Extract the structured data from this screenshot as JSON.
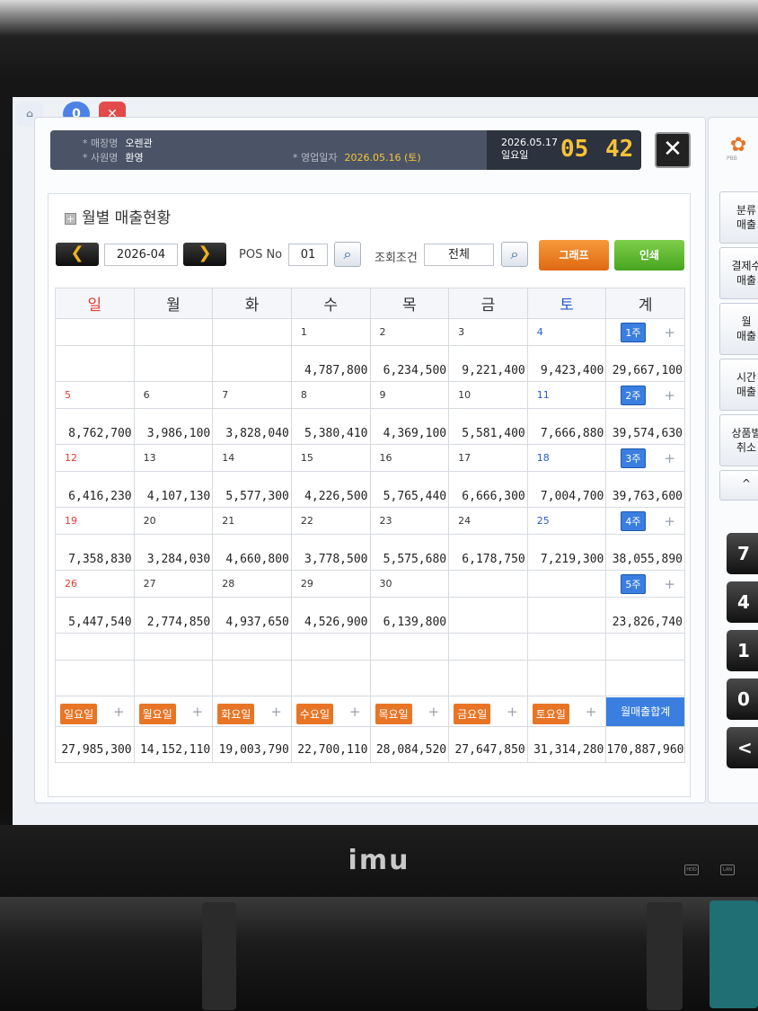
{
  "top_icons": {
    "user_count": "0"
  },
  "info": {
    "store_label": "* 매장명",
    "store_value": "오렌관",
    "staff_label": "* 사원명",
    "staff_value": "환영",
    "bizdate_label": "* 영업일자",
    "bizdate_value": "2026.05.16 (토)",
    "date": "2026.05.17",
    "weekday": "일요일",
    "hour": "05",
    "minute": "42"
  },
  "panel": {
    "title": "월별 매출현황",
    "month": "2026-04",
    "pos_label": "POS No",
    "pos_value": "01",
    "cond_label": "조회조건",
    "cond_value": "전체",
    "graph_label": "그래프",
    "print_label": "인쇄"
  },
  "calendar": {
    "headers": [
      "일",
      "월",
      "화",
      "수",
      "목",
      "금",
      "토",
      "계"
    ],
    "weeks": [
      {
        "days": [
          "",
          "",
          "",
          "1",
          "2",
          "3",
          "4"
        ],
        "amounts": [
          "",
          "",
          "",
          "4,787,800",
          "6,234,500",
          "9,221,400",
          "9,423,400"
        ],
        "week_label": "1주",
        "total": "29,667,100"
      },
      {
        "days": [
          "5",
          "6",
          "7",
          "8",
          "9",
          "10",
          "11"
        ],
        "amounts": [
          "8,762,700",
          "3,986,100",
          "3,828,040",
          "5,380,410",
          "4,369,100",
          "5,581,400",
          "7,666,880"
        ],
        "week_label": "2주",
        "total": "39,574,630"
      },
      {
        "days": [
          "12",
          "13",
          "14",
          "15",
          "16",
          "17",
          "18"
        ],
        "amounts": [
          "6,416,230",
          "4,107,130",
          "5,577,300",
          "4,226,500",
          "5,765,440",
          "6,666,300",
          "7,004,700"
        ],
        "week_label": "3주",
        "total": "39,763,600"
      },
      {
        "days": [
          "19",
          "20",
          "21",
          "22",
          "23",
          "24",
          "25"
        ],
        "amounts": [
          "7,358,830",
          "3,284,030",
          "4,660,800",
          "3,778,500",
          "5,575,680",
          "6,178,750",
          "7,219,300"
        ],
        "week_label": "4주",
        "total": "38,055,890"
      },
      {
        "days": [
          "26",
          "27",
          "28",
          "29",
          "30",
          "",
          ""
        ],
        "amounts": [
          "5,447,540",
          "2,774,850",
          "4,937,650",
          "4,526,900",
          "6,139,800",
          "",
          ""
        ],
        "week_label": "5주",
        "total": "23,826,740"
      }
    ],
    "day_totals": {
      "labels": [
        "일요일",
        "월요일",
        "화요일",
        "수요일",
        "목요일",
        "금요일",
        "토요일"
      ],
      "plus": "+",
      "values": [
        "27,985,300",
        "14,152,110",
        "19,003,790",
        "22,700,110",
        "28,084,520",
        "27,647,850",
        "31,314,280"
      ],
      "month_label": "월매출합계",
      "month_total": "170,887,960"
    }
  },
  "sidebar": {
    "logo_text": "PBB",
    "buttons": [
      "분류\n매출",
      "결제수\n매출",
      "월\n매출",
      "시간\n매출",
      "상품별\n취소"
    ],
    "up_arrow": "^",
    "keys": [
      "7",
      "4",
      "1",
      "0",
      "<"
    ]
  },
  "hardware": {
    "brand": "imu",
    "btn1": "HDD",
    "btn2": "LAN"
  },
  "colors": {
    "accent_blue": "#3a7ee0",
    "accent_orange": "#e87526",
    "sunday": "#e23b2e",
    "saturday": "#2a5cc8",
    "clock": "#f6c23a"
  }
}
